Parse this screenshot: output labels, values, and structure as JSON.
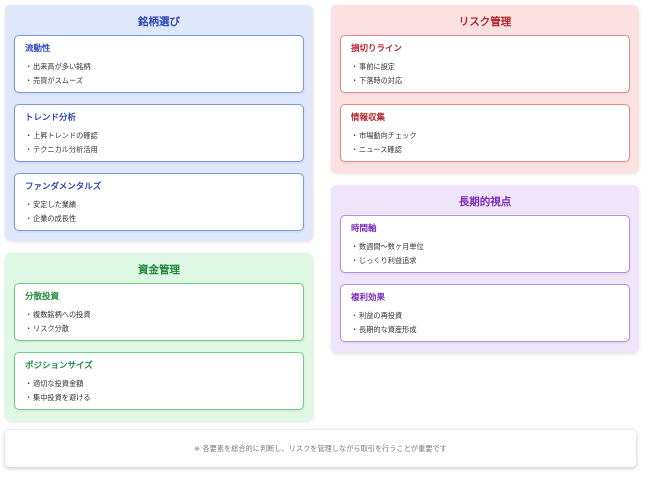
{
  "panels": {
    "stock": {
      "title": "銘柄選び",
      "cards": [
        {
          "title": "流動性",
          "items": [
            "出来高が多い銘柄",
            "売買がスムーズ"
          ]
        },
        {
          "title": "トレンド分析",
          "items": [
            "上昇トレンドの確認",
            "テクニカル分析活用"
          ]
        },
        {
          "title": "ファンダメンタルズ",
          "items": [
            "安定した業績",
            "企業の成長性"
          ]
        }
      ]
    },
    "risk": {
      "title": "リスク管理",
      "cards": [
        {
          "title": "損切りライン",
          "items": [
            "事前に設定",
            "下落時の対応"
          ]
        },
        {
          "title": "情報収集",
          "items": [
            "市場動向チェック",
            "ニュース確認"
          ]
        }
      ]
    },
    "money": {
      "title": "資金管理",
      "cards": [
        {
          "title": "分散投資",
          "items": [
            "複数銘柄への投資",
            "リスク分散"
          ]
        },
        {
          "title": "ポジションサイズ",
          "items": [
            "適切な投資金額",
            "集中投資を避ける"
          ]
        }
      ]
    },
    "long": {
      "title": "長期的視点",
      "cards": [
        {
          "title": "時間軸",
          "items": [
            "数週間〜数ヶ月単位",
            "じっくり利益追求"
          ]
        },
        {
          "title": "複利効果",
          "items": [
            "利益の再投資",
            "長期的な資産形成"
          ]
        }
      ]
    }
  },
  "bullet": "・",
  "footer": {
    "note": "※ 各要素を総合的に判断し、リスクを管理しながら取引を行うことが重要です"
  }
}
